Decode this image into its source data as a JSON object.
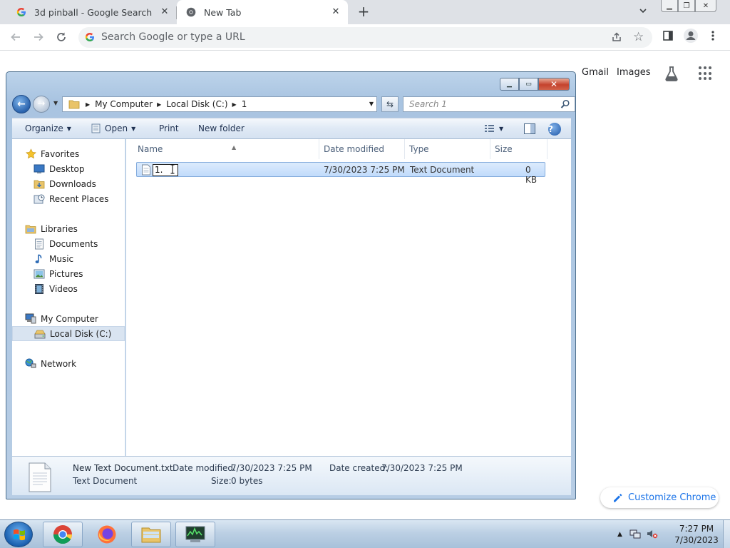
{
  "browser": {
    "tabs": [
      {
        "title": "3d pinball - Google Search",
        "active": false
      },
      {
        "title": "New Tab",
        "active": true
      }
    ],
    "omnibox_placeholder": "Search Google or type a URL",
    "ntp": {
      "gmail": "Gmail",
      "images": "Images",
      "customize": "Customize Chrome"
    }
  },
  "explorer": {
    "breadcrumbs": [
      "My Computer",
      "Local Disk (C:)",
      "1"
    ],
    "search_placeholder": "Search 1",
    "commands": {
      "organize": "Organize",
      "open": "Open",
      "print": "Print",
      "new_folder": "New folder"
    },
    "nav": {
      "favorites": "Favorites",
      "desktop": "Desktop",
      "downloads": "Downloads",
      "recent_places": "Recent Places",
      "libraries": "Libraries",
      "documents": "Documents",
      "music": "Music",
      "pictures": "Pictures",
      "videos": "Videos",
      "my_computer": "My Computer",
      "local_disk": "Local Disk (C:)",
      "network": "Network"
    },
    "columns": [
      "Name",
      "Date modified",
      "Type",
      "Size"
    ],
    "file": {
      "rename_text": "1.",
      "date_modified": "7/30/2023 7:25 PM",
      "type": "Text Document",
      "size": "0 KB"
    },
    "details": {
      "filename": "New Text Document.txt",
      "filetype": "Text Document",
      "date_modified_label": "Date modified:",
      "date_modified": "7/30/2023 7:25 PM",
      "date_created_label": "Date created:",
      "date_created": "7/30/2023 7:25 PM",
      "size_label": "Size:",
      "size": "0 bytes"
    }
  },
  "taskbar": {
    "time": "7:27 PM",
    "date": "7/30/2023"
  }
}
